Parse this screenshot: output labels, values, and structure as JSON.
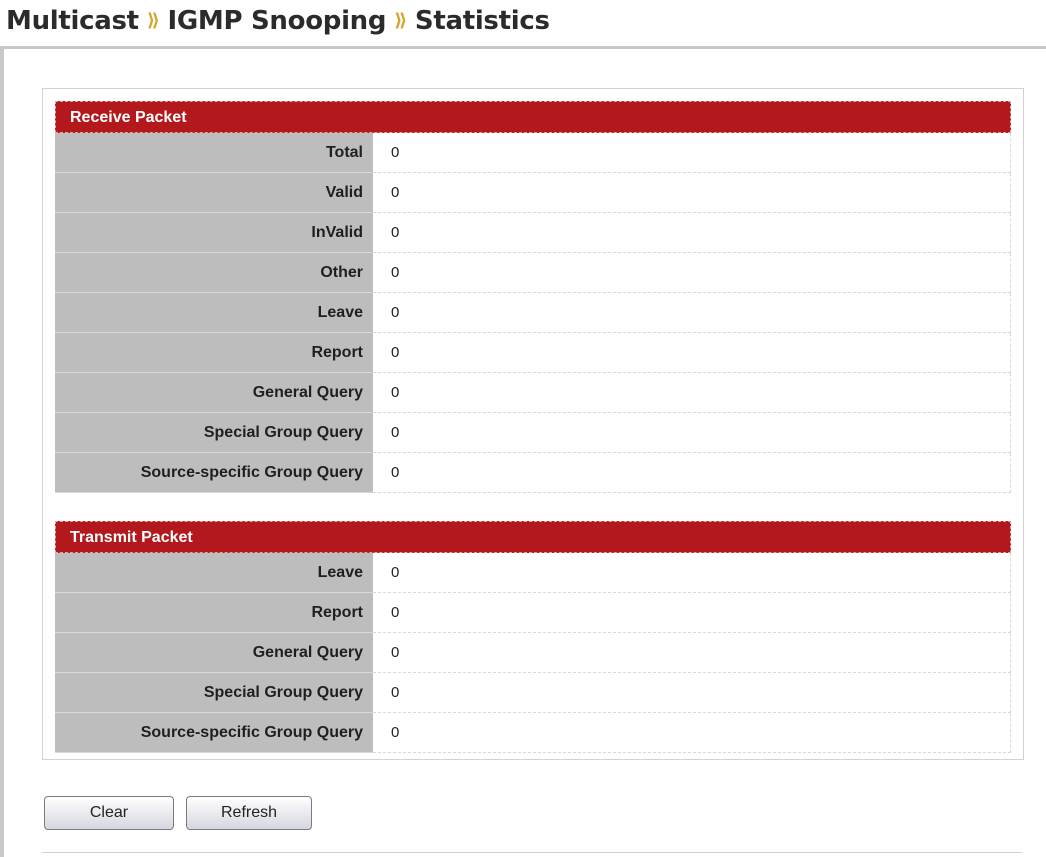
{
  "breadcrumb": {
    "items": [
      "Multicast",
      "IGMP Snooping",
      "Statistics"
    ],
    "separator": "⟫"
  },
  "receive": {
    "header": "Receive Packet",
    "rows": [
      {
        "label": "Total",
        "value": "0"
      },
      {
        "label": "Valid",
        "value": "0"
      },
      {
        "label": "InValid",
        "value": "0"
      },
      {
        "label": "Other",
        "value": "0"
      },
      {
        "label": "Leave",
        "value": "0"
      },
      {
        "label": "Report",
        "value": "0"
      },
      {
        "label": "General Query",
        "value": "0"
      },
      {
        "label": "Special Group Query",
        "value": "0"
      },
      {
        "label": "Source-specific Group Query",
        "value": "0"
      }
    ]
  },
  "transmit": {
    "header": "Transmit Packet",
    "rows": [
      {
        "label": "Leave",
        "value": "0"
      },
      {
        "label": "Report",
        "value": "0"
      },
      {
        "label": "General Query",
        "value": "0"
      },
      {
        "label": "Special Group Query",
        "value": "0"
      },
      {
        "label": "Source-specific Group Query",
        "value": "0"
      }
    ]
  },
  "buttons": {
    "clear": "Clear",
    "refresh": "Refresh"
  },
  "colors": {
    "section_header": "#b3191c",
    "label_bg": "#bdbdbd",
    "separator": "#d4a62a"
  }
}
